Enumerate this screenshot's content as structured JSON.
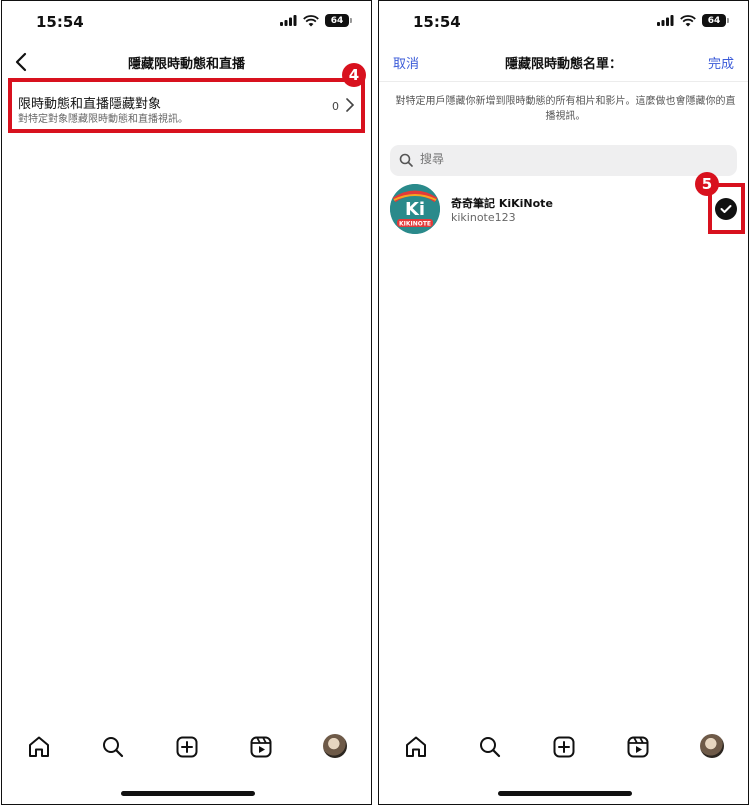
{
  "status": {
    "time": "15:54",
    "battery": "64"
  },
  "left": {
    "title": "隱藏限時動態和直播",
    "row": {
      "title": "限時動態和直播隱藏對象",
      "subtitle": "對特定對象隱藏限時動態和直播視訊。",
      "count": "0"
    },
    "step": "4"
  },
  "right": {
    "cancel": "取消",
    "title": "隱藏限時動態名單：",
    "done": "完成",
    "description": "對特定用戶隱藏你新增到限時動態的所有相片和影片。這麼做也會隱藏你的直播視訊。",
    "search_placeholder": "搜尋",
    "user": {
      "name": "奇奇筆記 KiKiNote",
      "handle": "kikinote123",
      "avatar_text": "Ki",
      "avatar_banner": "KIKINOTE"
    },
    "step": "5"
  },
  "tabs": [
    "home-icon",
    "search-icon",
    "create-icon",
    "reels-icon",
    "profile-avatar"
  ],
  "colors": {
    "highlight": "#d8111e",
    "link": "#3b5bd8",
    "avatar_bg": "#2a8a8b"
  }
}
